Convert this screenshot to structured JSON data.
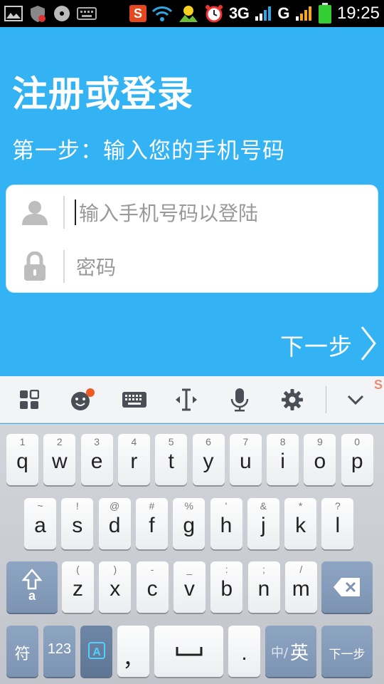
{
  "status_bar": {
    "network_3g": "3G",
    "network_g": "G",
    "time": "19:25",
    "app_badge": "S",
    "icons": [
      "image-icon",
      "shield-icon",
      "disc-icon",
      "keyboard-icon",
      "sogou-icon",
      "wifi-icon",
      "weather-icon",
      "alarm-icon",
      "signal-icon",
      "signal-icon",
      "battery-icon"
    ]
  },
  "header": {
    "title": "注册或登录",
    "step": "第一步：输入您的手机号码"
  },
  "form": {
    "phone_placeholder": "输入手机号码以登陆",
    "password_placeholder": "密码"
  },
  "next": {
    "label": "下一步"
  },
  "ime_toolbar": {
    "items": [
      "grid-icon",
      "emoji-icon",
      "keyboard-icon",
      "cursor-move-icon",
      "microphone-icon",
      "gear-icon",
      "chevron-down-icon"
    ],
    "notification_dot_color": "#f05a24",
    "brand": "S"
  },
  "keyboard": {
    "row1": [
      {
        "main": "q",
        "sub": "1"
      },
      {
        "main": "w",
        "sub": "2"
      },
      {
        "main": "e",
        "sub": "3"
      },
      {
        "main": "r",
        "sub": "4"
      },
      {
        "main": "t",
        "sub": "5"
      },
      {
        "main": "y",
        "sub": "6"
      },
      {
        "main": "u",
        "sub": "7"
      },
      {
        "main": "i",
        "sub": "8"
      },
      {
        "main": "o",
        "sub": "9"
      },
      {
        "main": "p",
        "sub": "0"
      }
    ],
    "row2": [
      {
        "main": "a",
        "sub": "~"
      },
      {
        "main": "s",
        "sub": "!"
      },
      {
        "main": "d",
        "sub": "@"
      },
      {
        "main": "f",
        "sub": "#"
      },
      {
        "main": "g",
        "sub": "%"
      },
      {
        "main": "h",
        "sub": "'"
      },
      {
        "main": "j",
        "sub": "&"
      },
      {
        "main": "k",
        "sub": "*"
      },
      {
        "main": "l",
        "sub": "?"
      }
    ],
    "row3": [
      {
        "main": "z",
        "sub": "("
      },
      {
        "main": "x",
        "sub": ")"
      },
      {
        "main": "c",
        "sub": "-"
      },
      {
        "main": "v",
        "sub": "_"
      },
      {
        "main": "b",
        "sub": ":"
      },
      {
        "main": "n",
        "sub": ";"
      },
      {
        "main": "m",
        "sub": "/"
      }
    ],
    "shift_label": "a",
    "bottom": {
      "symbols": "符",
      "numbers": "123",
      "comma": "，",
      "period": ".",
      "lang_zh": "中/",
      "lang_en": "英",
      "enter": "下一步"
    },
    "accent_color": "#7c93b2"
  },
  "colors": {
    "background": "#33b3f3",
    "card": "#ffffff",
    "placeholder": "#999999"
  }
}
